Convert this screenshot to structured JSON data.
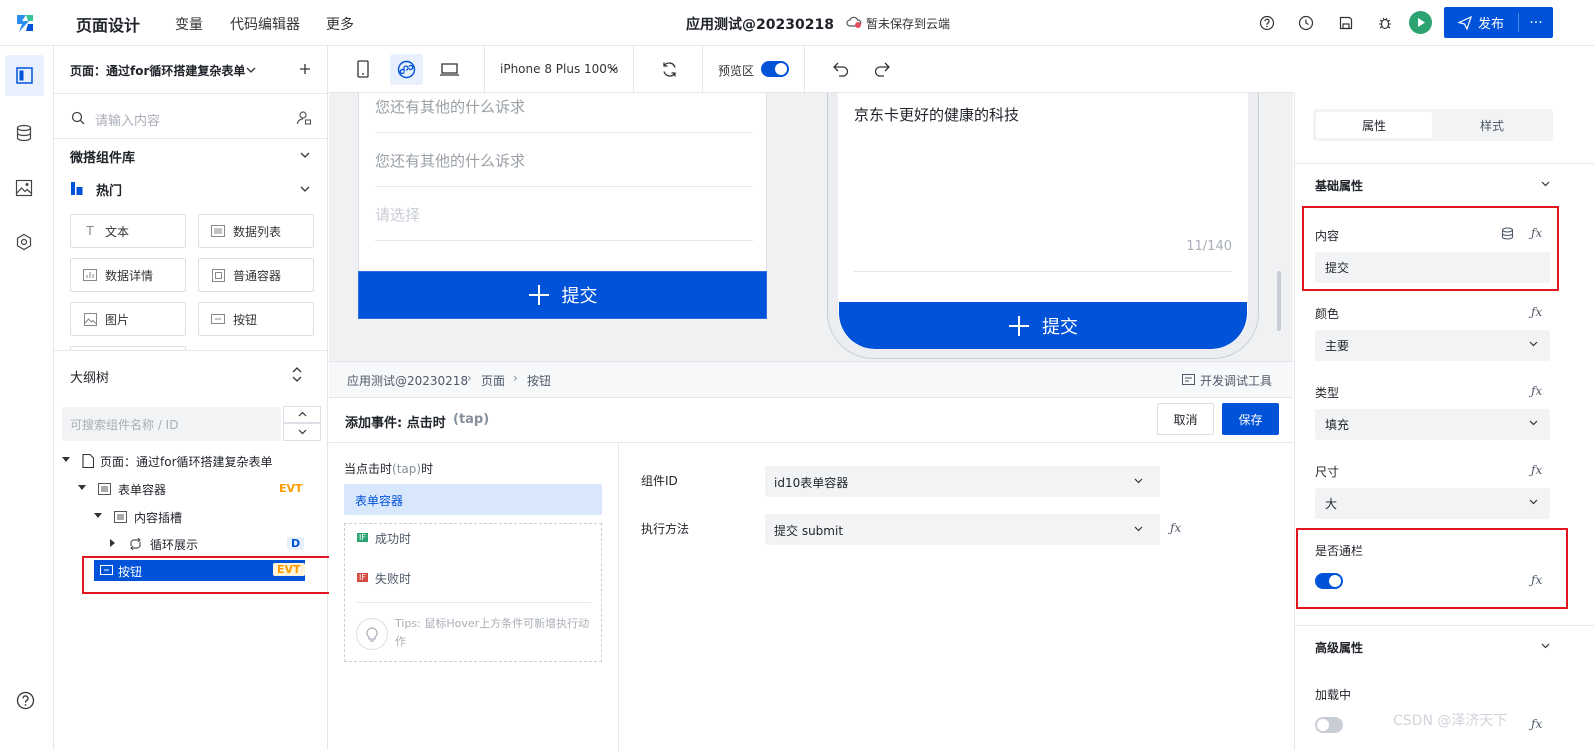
{
  "topbar": {
    "title": "页面设计",
    "nav": [
      "变量",
      "代码编辑器",
      "更多"
    ],
    "app_name": "应用测试@20230218",
    "save_status": "暂未保存到云端",
    "publish_label": "发布",
    "more_label": "···"
  },
  "left_panel": {
    "page_select": "页面：通过for循环搭建复杂表单",
    "search_placeholder": "请输入内容",
    "library_title": "微搭组件库",
    "hot_title": "热门",
    "components": [
      {
        "label": "文本",
        "icon": "text-icon"
      },
      {
        "label": "数据列表",
        "icon": "list-icon"
      },
      {
        "label": "数据详情",
        "icon": "chart-icon"
      },
      {
        "label": "普通容器",
        "icon": "container-icon"
      },
      {
        "label": "图片",
        "icon": "image-icon"
      },
      {
        "label": "按钮",
        "icon": "button-icon"
      }
    ],
    "outline_title": "大纲树",
    "outline_search_placeholder": "可搜索组件名称 / ID",
    "tree": [
      {
        "label": "页面：通过for循环搭建复杂表单",
        "badge": ""
      },
      {
        "label": "表单容器",
        "badge": "EVT"
      },
      {
        "label": "内容插槽",
        "badge": ""
      },
      {
        "label": "循环展示",
        "badge": "D"
      },
      {
        "label": "按钮",
        "badge": "EVT"
      }
    ]
  },
  "toolbar": {
    "device": "iPhone 8 Plus 100%",
    "preview_label": "预览区",
    "preview_on": true
  },
  "canvas": {
    "left_fields": [
      "您还有其他的什么诉求",
      "您还有其他的什么诉求",
      "请选择"
    ],
    "left_submit": "提交",
    "right_text": "京东卡更好的健康的科技",
    "char_count": "11/140",
    "right_submit": "提交"
  },
  "editor": {
    "breadcrumb": [
      "应用测试@20230218",
      "页面",
      "按钮"
    ],
    "devtools_label": "开发调试工具",
    "event_title": "添加事件: 点击时",
    "event_code": "(tap)",
    "cancel_label": "取消",
    "save_label": "保存",
    "trigger_prefix": "当点击时",
    "trigger_code": "(tap)",
    "trigger_suffix": "时",
    "selected_action": "表单容器",
    "success_label": "成功时",
    "fail_label": "失败时",
    "if_tag": "IF",
    "tips": "Tips: 鼠标Hover上方条件可新增执行动作",
    "component_id_label": "组件ID",
    "component_id_value": "id10表单容器",
    "method_label": "执行方法",
    "method_value": "提交 submit",
    "fx": "ƒx"
  },
  "right_panel": {
    "tabs": [
      "属性",
      "样式"
    ],
    "active_tab": "属性",
    "basic_title": "基础属性",
    "content_label": "内容",
    "content_value": "提交",
    "color_label": "颜色",
    "color_value": "主要",
    "type_label": "类型",
    "type_value": "填充",
    "size_label": "尺寸",
    "size_value": "大",
    "block_label": "是否通栏",
    "block_on": true,
    "advanced_title": "高级属性",
    "loading_label": "加载中",
    "loading_on": false,
    "fx": "ƒx"
  },
  "watermark": "CSDN @泽济天下",
  "colors": {
    "primary": "#0052d9",
    "highlight": "#e0171f",
    "evt": "#ff9c00",
    "success": "#2ba471",
    "danger": "#d54941"
  }
}
